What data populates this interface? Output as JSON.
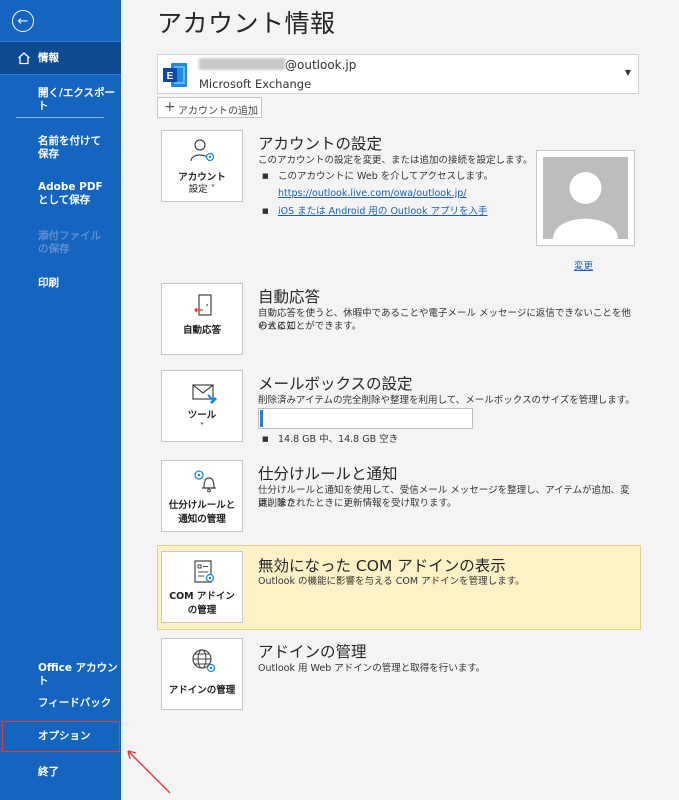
{
  "sidebar": {
    "back_label": "←",
    "items": [
      {
        "label": "情報"
      },
      {
        "label": "開く/エクスポート"
      },
      {
        "label": "名前を付けて保存"
      },
      {
        "label": "Adobe PDF として保存"
      },
      {
        "label": "添付ファイルの保存"
      },
      {
        "label": "印刷"
      },
      {
        "label": "Office アカウント"
      },
      {
        "label": "フィードバック"
      },
      {
        "label": "オプション"
      },
      {
        "label": "終了"
      }
    ],
    "bg_color": "#1565c0",
    "active_color": "#0d4a92",
    "highlight_color": "#e53935"
  },
  "main": {
    "title": "アカウント情報",
    "account": {
      "email_suffix": "@outlook.jp",
      "type": "Microsoft Exchange"
    },
    "add_account_label": "アカウントの追加",
    "sections": {
      "account_settings": {
        "button_label_1": "アカウント",
        "button_label_2": "設定 ˅",
        "title": "アカウントの設定",
        "desc": "このアカウントの設定を変更、または追加の接続を設定します。",
        "bullet1": "このアカウントに Web を介してアクセスします。",
        "link1": "https://outlook.live.com/owa/outlook.jp/",
        "link2": "iOS または Android 用の Outlook アプリを入手",
        "change_link": "変更"
      },
      "auto_reply": {
        "button_label": "自動応答",
        "title": "自動応答",
        "desc_line1": "自動応答を使うと、休暇中であることや電子メール メッセージに返信できないことを他の人に知",
        "desc_line2": "らせることができます。"
      },
      "mailbox": {
        "button_label": "ツール",
        "button_caret": "˅",
        "title": "メールボックスの設定",
        "desc": "削除済みアイテムの完全削除や整理を利用して、メールボックスのサイズを管理します。",
        "usage": "14.8 GB 中、14.8 GB 空き",
        "used_fraction": 0.01
      },
      "rules": {
        "button_label_1": "仕分けルールと",
        "button_label_2": "通知の管理",
        "title": "仕分けルールと通知",
        "desc_line1": "仕分けルールと通知を使用して、受信メール メッセージを整理し、アイテムが追加、変更、また",
        "desc_line2": "は削除されたときに更新情報を受け取ります。"
      },
      "com_addins": {
        "button_label_1": "COM アドイン",
        "button_label_2": "の管理",
        "title": "無効になった COM アドインの表示",
        "desc": "Outlook の機能に影響を与える COM アドインを管理します。"
      },
      "addins": {
        "button_label": "アドインの管理",
        "title": "アドインの管理",
        "desc": "Outlook 用 Web アドインの管理と取得を行います。"
      }
    }
  }
}
